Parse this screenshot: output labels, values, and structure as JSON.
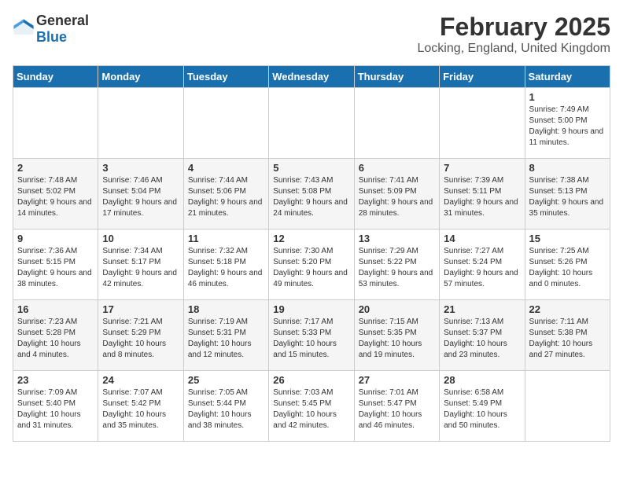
{
  "header": {
    "logo_general": "General",
    "logo_blue": "Blue",
    "month_year": "February 2025",
    "location": "Locking, England, United Kingdom"
  },
  "days_of_week": [
    "Sunday",
    "Monday",
    "Tuesday",
    "Wednesday",
    "Thursday",
    "Friday",
    "Saturday"
  ],
  "weeks": [
    [
      {
        "day": "",
        "info": ""
      },
      {
        "day": "",
        "info": ""
      },
      {
        "day": "",
        "info": ""
      },
      {
        "day": "",
        "info": ""
      },
      {
        "day": "",
        "info": ""
      },
      {
        "day": "",
        "info": ""
      },
      {
        "day": "1",
        "info": "Sunrise: 7:49 AM\nSunset: 5:00 PM\nDaylight: 9 hours and 11 minutes."
      }
    ],
    [
      {
        "day": "2",
        "info": "Sunrise: 7:48 AM\nSunset: 5:02 PM\nDaylight: 9 hours and 14 minutes."
      },
      {
        "day": "3",
        "info": "Sunrise: 7:46 AM\nSunset: 5:04 PM\nDaylight: 9 hours and 17 minutes."
      },
      {
        "day": "4",
        "info": "Sunrise: 7:44 AM\nSunset: 5:06 PM\nDaylight: 9 hours and 21 minutes."
      },
      {
        "day": "5",
        "info": "Sunrise: 7:43 AM\nSunset: 5:08 PM\nDaylight: 9 hours and 24 minutes."
      },
      {
        "day": "6",
        "info": "Sunrise: 7:41 AM\nSunset: 5:09 PM\nDaylight: 9 hours and 28 minutes."
      },
      {
        "day": "7",
        "info": "Sunrise: 7:39 AM\nSunset: 5:11 PM\nDaylight: 9 hours and 31 minutes."
      },
      {
        "day": "8",
        "info": "Sunrise: 7:38 AM\nSunset: 5:13 PM\nDaylight: 9 hours and 35 minutes."
      }
    ],
    [
      {
        "day": "9",
        "info": "Sunrise: 7:36 AM\nSunset: 5:15 PM\nDaylight: 9 hours and 38 minutes."
      },
      {
        "day": "10",
        "info": "Sunrise: 7:34 AM\nSunset: 5:17 PM\nDaylight: 9 hours and 42 minutes."
      },
      {
        "day": "11",
        "info": "Sunrise: 7:32 AM\nSunset: 5:18 PM\nDaylight: 9 hours and 46 minutes."
      },
      {
        "day": "12",
        "info": "Sunrise: 7:30 AM\nSunset: 5:20 PM\nDaylight: 9 hours and 49 minutes."
      },
      {
        "day": "13",
        "info": "Sunrise: 7:29 AM\nSunset: 5:22 PM\nDaylight: 9 hours and 53 minutes."
      },
      {
        "day": "14",
        "info": "Sunrise: 7:27 AM\nSunset: 5:24 PM\nDaylight: 9 hours and 57 minutes."
      },
      {
        "day": "15",
        "info": "Sunrise: 7:25 AM\nSunset: 5:26 PM\nDaylight: 10 hours and 0 minutes."
      }
    ],
    [
      {
        "day": "16",
        "info": "Sunrise: 7:23 AM\nSunset: 5:28 PM\nDaylight: 10 hours and 4 minutes."
      },
      {
        "day": "17",
        "info": "Sunrise: 7:21 AM\nSunset: 5:29 PM\nDaylight: 10 hours and 8 minutes."
      },
      {
        "day": "18",
        "info": "Sunrise: 7:19 AM\nSunset: 5:31 PM\nDaylight: 10 hours and 12 minutes."
      },
      {
        "day": "19",
        "info": "Sunrise: 7:17 AM\nSunset: 5:33 PM\nDaylight: 10 hours and 15 minutes."
      },
      {
        "day": "20",
        "info": "Sunrise: 7:15 AM\nSunset: 5:35 PM\nDaylight: 10 hours and 19 minutes."
      },
      {
        "day": "21",
        "info": "Sunrise: 7:13 AM\nSunset: 5:37 PM\nDaylight: 10 hours and 23 minutes."
      },
      {
        "day": "22",
        "info": "Sunrise: 7:11 AM\nSunset: 5:38 PM\nDaylight: 10 hours and 27 minutes."
      }
    ],
    [
      {
        "day": "23",
        "info": "Sunrise: 7:09 AM\nSunset: 5:40 PM\nDaylight: 10 hours and 31 minutes."
      },
      {
        "day": "24",
        "info": "Sunrise: 7:07 AM\nSunset: 5:42 PM\nDaylight: 10 hours and 35 minutes."
      },
      {
        "day": "25",
        "info": "Sunrise: 7:05 AM\nSunset: 5:44 PM\nDaylight: 10 hours and 38 minutes."
      },
      {
        "day": "26",
        "info": "Sunrise: 7:03 AM\nSunset: 5:45 PM\nDaylight: 10 hours and 42 minutes."
      },
      {
        "day": "27",
        "info": "Sunrise: 7:01 AM\nSunset: 5:47 PM\nDaylight: 10 hours and 46 minutes."
      },
      {
        "day": "28",
        "info": "Sunrise: 6:58 AM\nSunset: 5:49 PM\nDaylight: 10 hours and 50 minutes."
      },
      {
        "day": "",
        "info": ""
      }
    ]
  ]
}
